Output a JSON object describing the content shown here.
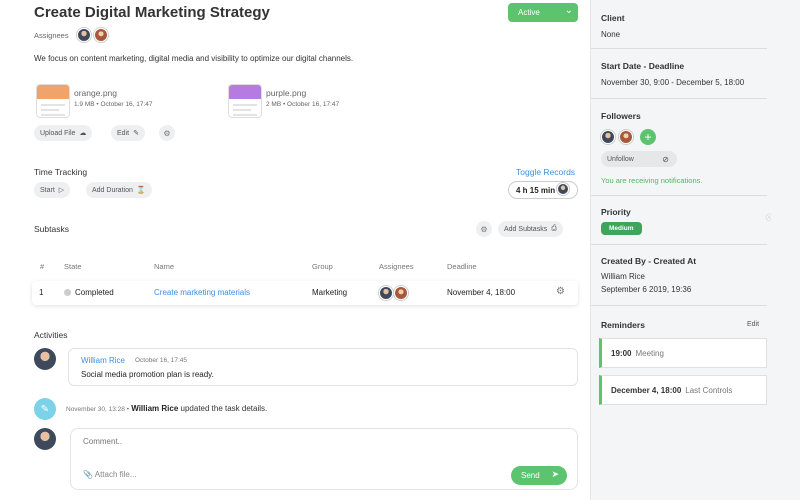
{
  "task": {
    "title": "Create Digital Marketing Strategy",
    "status": "Active",
    "assignees_label": "Assignees",
    "description": "We focus on content marketing, digital media and visibility to optimize our digital channels."
  },
  "files": [
    {
      "name": "orange.png",
      "meta": "1.9 MB • October 16, 17:47",
      "color": "#f0a46a"
    },
    {
      "name": "purple.png",
      "meta": "2 MB • October 16, 17:47",
      "color": "#b57be0"
    }
  ],
  "file_actions": {
    "upload": "Upload File",
    "edit": "Edit"
  },
  "time_tracking": {
    "title": "Time Tracking",
    "toggle": "Toggle Records",
    "start": "Start",
    "add_duration": "Add Duration",
    "total": "4 h 15 min"
  },
  "subtasks": {
    "title": "Subtasks",
    "add": "Add Subtasks",
    "columns": [
      "#",
      "State",
      "Name",
      "Group",
      "Assignees",
      "Deadline"
    ],
    "rows": [
      {
        "num": "1",
        "state": "Completed",
        "name": "Create marketing materials",
        "group": "Marketing",
        "deadline": "November 4, 18:00"
      }
    ]
  },
  "activities": {
    "title": "Activities",
    "comment": {
      "author": "William Rice",
      "time": "October 16, 17:45",
      "text": "Social media promotion plan is ready."
    },
    "update": {
      "time": "November 30, 13:28 •",
      "author": "William Rice",
      "text": "updated the task details."
    },
    "composer": {
      "placeholder": "Comment..",
      "attach": "Attach file...",
      "send": "Send"
    }
  },
  "sidebar": {
    "client_label": "Client",
    "client_value": "None",
    "dates_label": "Start Date - Deadline",
    "dates_value": "November 30, 9:00 - December 5, 18:00",
    "followers_label": "Followers",
    "unfollow": "Unfollow",
    "notify": "You are receiving notifications.",
    "priority_label": "Priority",
    "priority_value": "Medium",
    "created_label": "Created By - Created At",
    "created_by": "William Rice",
    "created_at": "September 6 2019, 19:36",
    "reminders_label": "Reminders",
    "reminders_edit": "Edit",
    "reminders": [
      {
        "time": "19:00",
        "note": "Meeting"
      },
      {
        "time": "December 4, 18:00",
        "note": "Last Controls"
      }
    ]
  },
  "colors": {
    "accent": "#5cc46e",
    "link": "#3a8ee6",
    "priority": "#3fa55a"
  }
}
